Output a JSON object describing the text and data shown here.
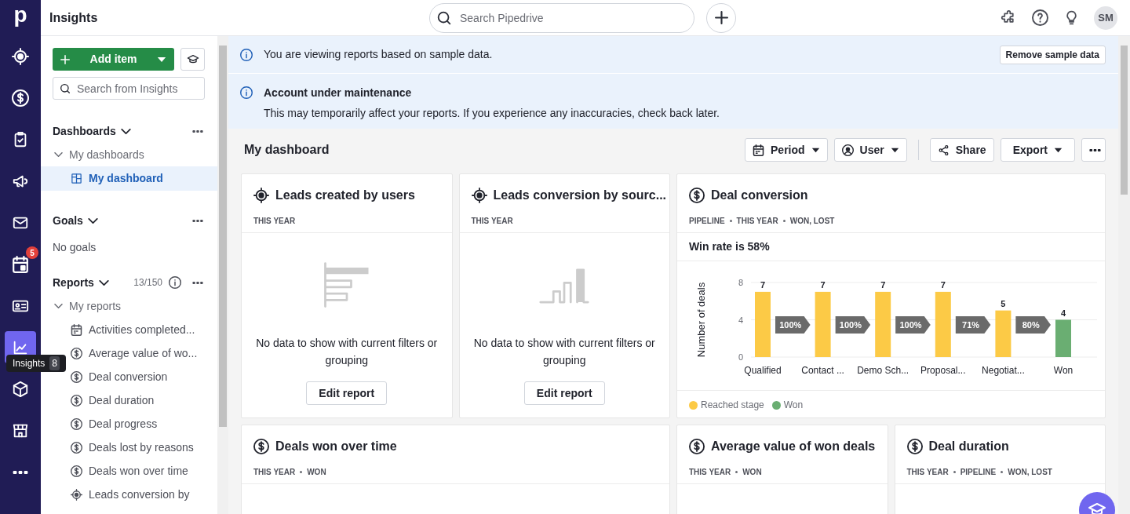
{
  "logo": "p",
  "topbar": {
    "title": "Insights",
    "search_placeholder": "Search Pipedrive",
    "avatar": "SM"
  },
  "nav_items": [
    {
      "selected": false
    },
    {
      "selected": false
    },
    {
      "selected": false
    },
    {
      "selected": false
    },
    {
      "selected": false
    },
    {
      "selected": false,
      "badge": "5"
    },
    {
      "selected": false
    },
    {
      "selected": true,
      "tooltip": "Insights",
      "tooltip_count": "8"
    },
    {
      "selected": false
    },
    {
      "selected": false
    },
    {
      "selected": false
    }
  ],
  "sidebar": {
    "add_button": "Add item",
    "search_placeholder": "Search from Insights",
    "dashboards": {
      "title": "Dashboards",
      "group": "My dashboards",
      "expanded": true,
      "items": [
        {
          "label": "My dashboard",
          "selected": true
        }
      ]
    },
    "goals": {
      "title": "Goals",
      "empty": "No goals"
    },
    "reports": {
      "title": "Reports",
      "count": "13/150",
      "group": "My reports",
      "expanded": true,
      "items": [
        {
          "label": "Activities completed...",
          "kind": "activities"
        },
        {
          "label": "Average value of wo...",
          "kind": "deals"
        },
        {
          "label": "Deal conversion",
          "kind": "deals"
        },
        {
          "label": "Deal duration",
          "kind": "deals"
        },
        {
          "label": "Deal progress",
          "kind": "deals"
        },
        {
          "label": "Deals lost by reasons",
          "kind": "deals"
        },
        {
          "label": "Deals won over time",
          "kind": "deals"
        },
        {
          "label": "Leads conversion by",
          "kind": "leads"
        }
      ]
    }
  },
  "banners": [
    {
      "kind": "sample",
      "text": "You are viewing reports based on sample data.",
      "button": "Remove sample data"
    },
    {
      "kind": "maintenance",
      "title": "Account under maintenance",
      "text": "This may temporarily affect your reports. If you experience any inaccuracies, check back later."
    }
  ],
  "dashboard": {
    "title": "My dashboard",
    "filters": [
      {
        "label": "Period",
        "kind": "period"
      },
      {
        "label": "User",
        "kind": "user"
      }
    ],
    "share": "Share",
    "export": "Export"
  },
  "cards": [
    [
      {
        "title": "Leads created by users",
        "kind": "leads",
        "tags": [
          "THIS YEAR"
        ],
        "body": {
          "kind": "empty",
          "illustration": {
            "kind": "bars"
          },
          "message": "No data to show with current filters or grouping",
          "button": "Edit report"
        }
      },
      {
        "title": "Leads conversion by sourc...",
        "kind": "leads",
        "tags": [
          "THIS YEAR"
        ],
        "body": {
          "kind": "empty",
          "illustration": {
            "kind": "columns"
          },
          "message": "No data to show with current filters or grouping",
          "button": "Edit report"
        }
      },
      {
        "title": "Deal conversion",
        "kind": "deals",
        "tags": [
          "PIPELINE",
          "THIS YEAR",
          "WON, LOST"
        ],
        "body": {
          "kind": "chart",
          "summary": "Win rate is 58%",
          "chart_data": {
            "type": "bar",
            "ylabel": "Number of deals",
            "categories": [
              "Qualified",
              "Contact ...",
              "Demo Sch...",
              "Proposal...",
              "Negotiat...",
              "Won"
            ],
            "stacked": true,
            "ylim": [
              0,
              8
            ],
            "yticks": [
              0,
              4,
              8
            ],
            "data_labels": true,
            "series": [
              {
                "name": "Reached stage",
                "color": "#fcca46",
                "values": [
                  7,
                  7,
                  7,
                  7,
                  5,
                  null
                ]
              },
              {
                "name": "Won",
                "color": "#6aae72",
                "values": [
                  null,
                  null,
                  null,
                  null,
                  null,
                  4
                ]
              }
            ],
            "annotations": [
              "100%",
              "100%",
              "100%",
              "71%",
              "80%"
            ]
          }
        }
      }
    ],
    [
      {
        "title": "Deals won over time",
        "kind": "deals",
        "tags": [
          "THIS YEAR",
          "WON"
        ],
        "body": {
          "kind": "chart"
        }
      },
      {
        "title": "Average value of won deals",
        "kind": "deals",
        "tags": [
          "THIS YEAR",
          "WON"
        ],
        "body": {
          "kind": "pending"
        }
      },
      {
        "title": "Deal duration",
        "kind": "deals",
        "tags": [
          "THIS YEAR",
          "PIPELINE",
          "WON, LOST"
        ],
        "body": {
          "kind": "pending"
        }
      }
    ]
  ]
}
